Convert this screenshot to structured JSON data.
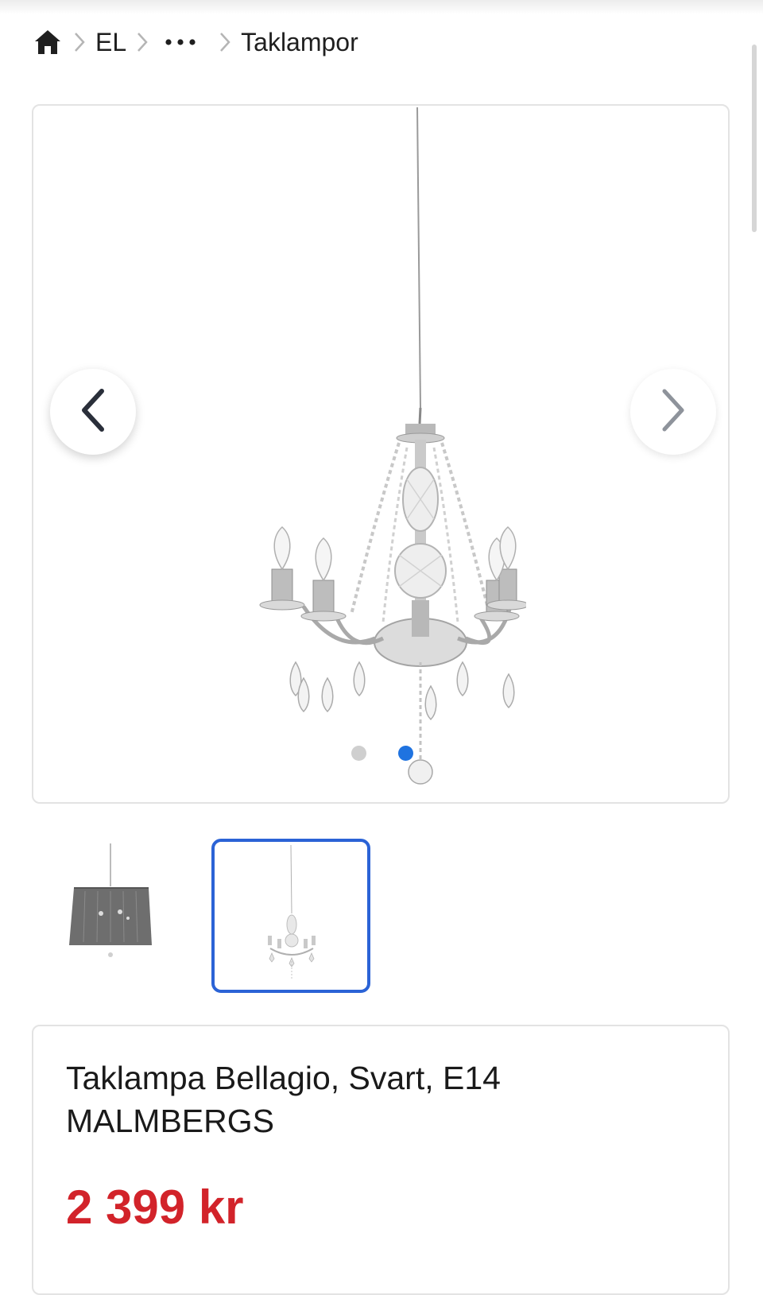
{
  "breadcrumb": {
    "home_icon": "home-icon",
    "items": [
      "EL",
      "Taklampor"
    ],
    "more_label": "•••"
  },
  "gallery": {
    "prev_icon": "chevron-left-icon",
    "next_icon": "chevron-right-icon",
    "image_count": 2,
    "active_index": 1,
    "active_dot_color": "#1f73e0",
    "inactive_dot_color": "#cfcfcf"
  },
  "thumbnails": [
    {
      "name": "thumbnail-pendant-shade",
      "selected": false
    },
    {
      "name": "thumbnail-chandelier",
      "selected": true
    }
  ],
  "product": {
    "title_line1": "Taklampa Bellagio, Svart, E14",
    "brand": "MALMBERGS",
    "price": "2 399 kr",
    "price_color": "#d2232a"
  }
}
